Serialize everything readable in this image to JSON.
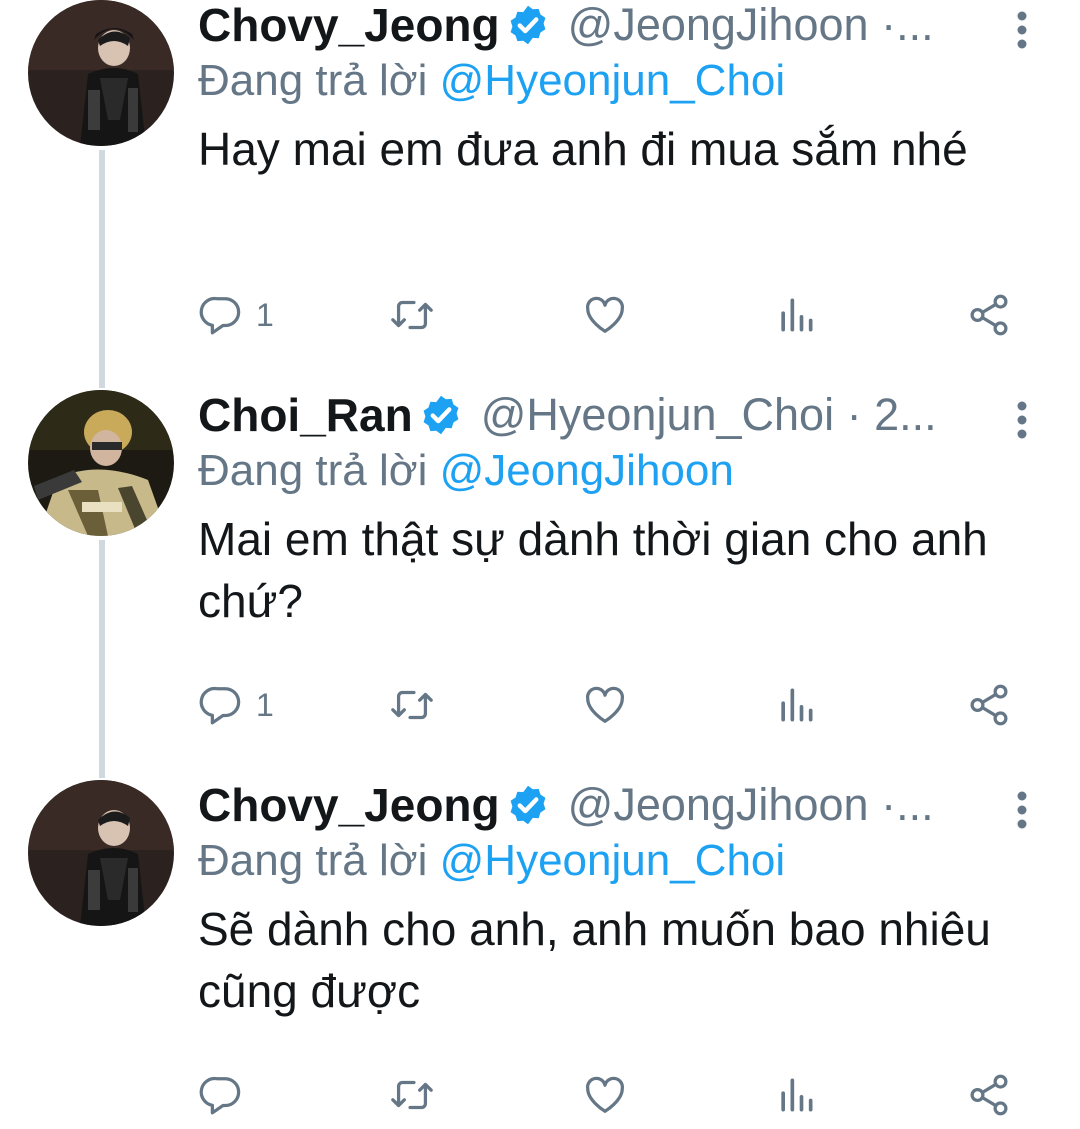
{
  "colors": {
    "text": "#14171a",
    "secondary": "#657786",
    "link": "#1da1f2",
    "verified": "#1da1f2",
    "thread_line": "#cfd9de"
  },
  "tweets": [
    {
      "name": "Chovy_Jeong",
      "handle": "@JeongJihoon",
      "separator": "·",
      "time": "...",
      "reply_label": "Đang trả lời",
      "reply_to": "@Hyeonjun_Choi",
      "text": "Hay mai em đưa anh đi mua sắm nhé",
      "reply_count": "1",
      "avatar_icon": "avatar-chovy"
    },
    {
      "name": "Choi_Ran",
      "handle": "@Hyeonjun_Choi",
      "separator": "·",
      "time": "2...",
      "reply_label": "Đang trả lời",
      "reply_to": "@JeongJihoon",
      "text": "Mai em thật sự dành thời gian cho anh chứ?",
      "reply_count": "1",
      "avatar_icon": "avatar-choi-ran"
    },
    {
      "name": "Chovy_Jeong",
      "handle": "@JeongJihoon",
      "separator": "·",
      "time": "...",
      "reply_label": "Đang trả lời",
      "reply_to": "@Hyeonjun_Choi",
      "text": "Sẽ dành cho anh, anh muốn bao nhiêu cũng được",
      "reply_count": "",
      "avatar_icon": "avatar-chovy"
    }
  ]
}
